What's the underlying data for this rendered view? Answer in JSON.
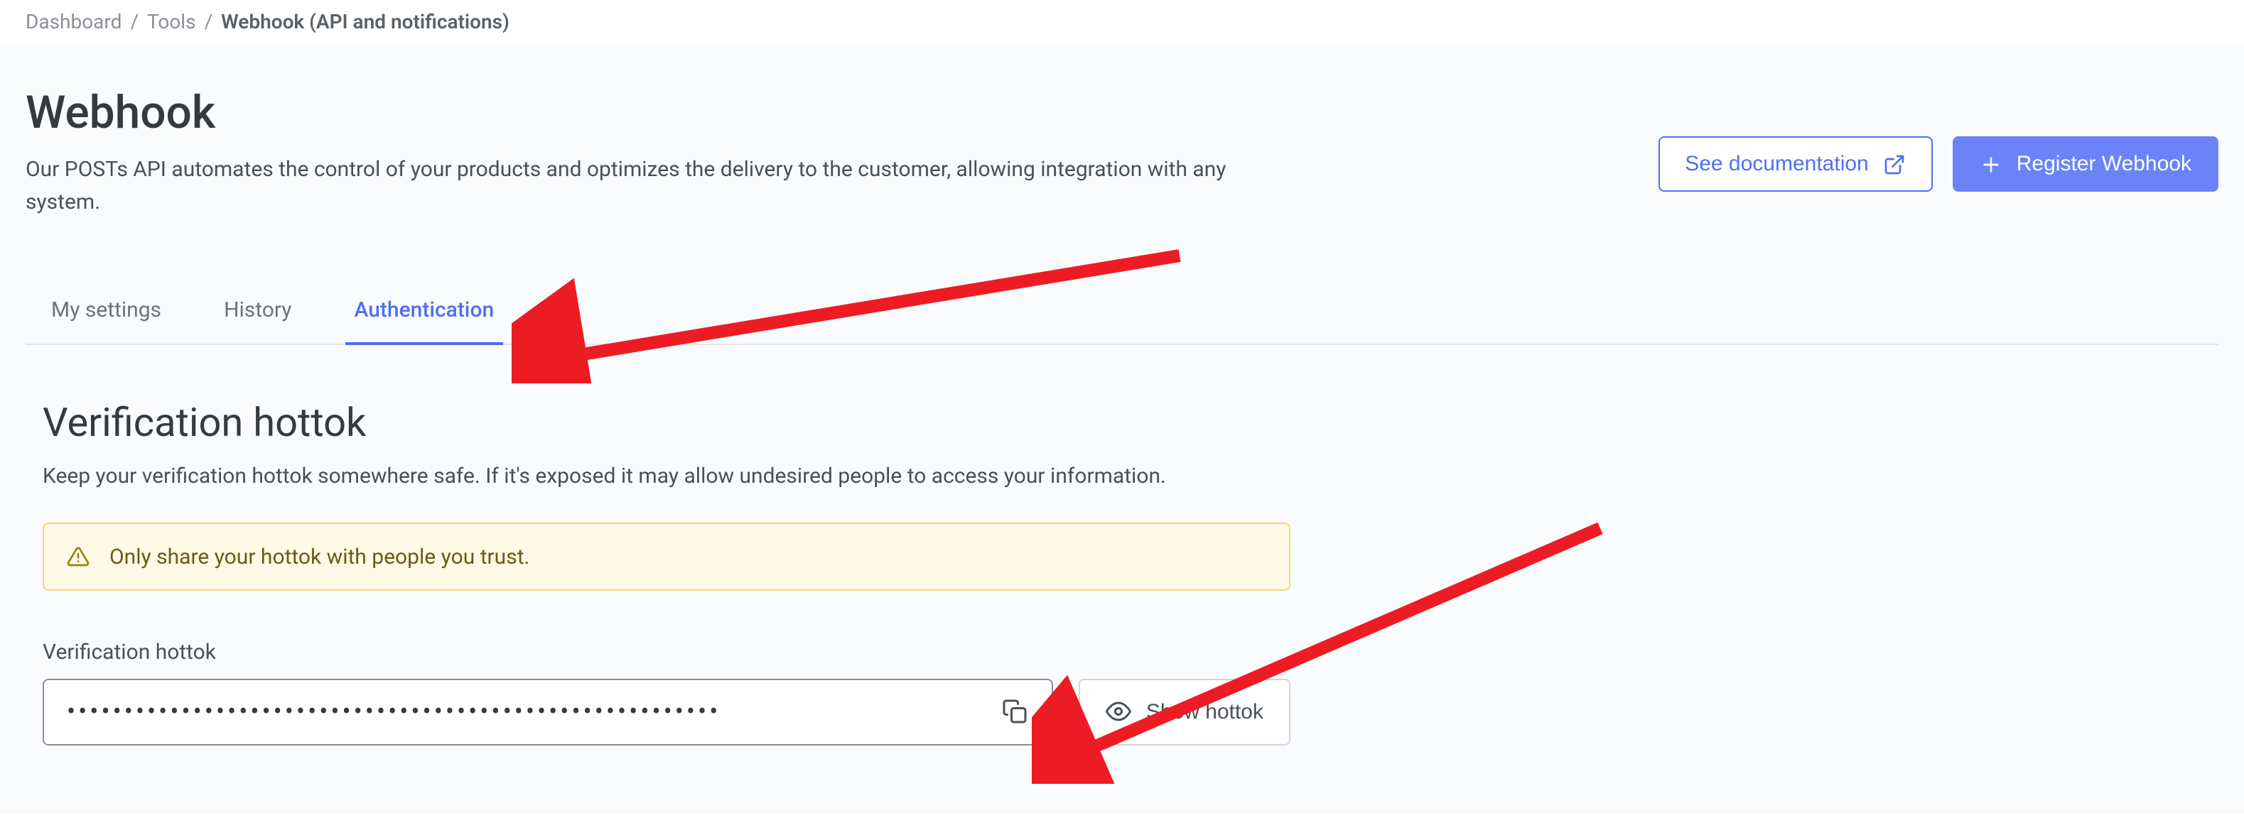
{
  "breadcrumb": {
    "items": [
      "Dashboard",
      "Tools",
      "Webhook (API and notifications)"
    ]
  },
  "page": {
    "title": "Webhook",
    "subtitle": "Our POSTs API automates the control of your products and optimizes the delivery to the customer, allowing integration with any system."
  },
  "actions": {
    "documentation_label": "See documentation",
    "register_label": "Register Webhook"
  },
  "tabs": {
    "items": [
      {
        "label": "My settings"
      },
      {
        "label": "History"
      },
      {
        "label": "Authentication"
      }
    ],
    "active_index": 2
  },
  "section": {
    "title": "Verification hottok",
    "subtitle": "Keep your verification hottok somewhere safe. If it's exposed it may allow undesired people to access your information."
  },
  "alert": {
    "text": "Only share your hottok with people you trust."
  },
  "form": {
    "label": "Verification hottok",
    "input_value": "•••••••••••••••••••••••••••••••••••••••••••••••••••••••••",
    "show_label": "Show hottok"
  }
}
